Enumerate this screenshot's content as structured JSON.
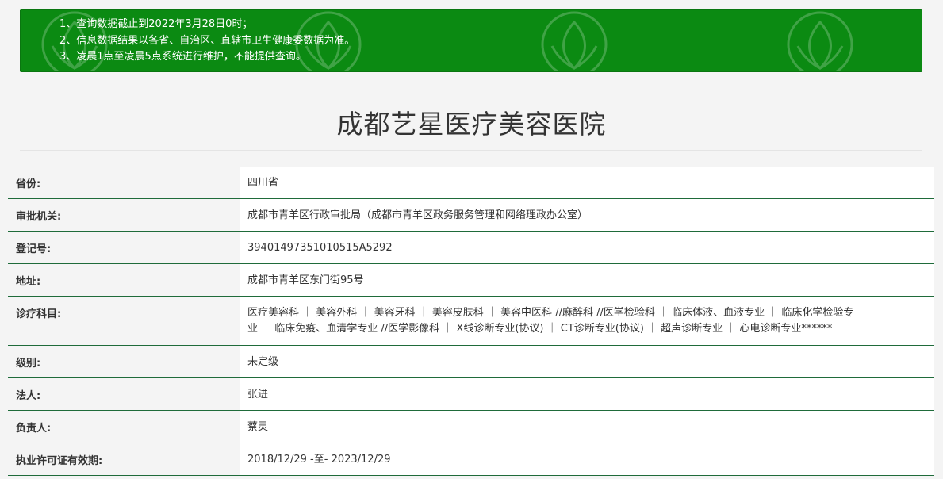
{
  "notice": {
    "items": [
      {
        "num": "1",
        "text": "查询数据截止到2022年3月28日0时；"
      },
      {
        "num": "2",
        "text": "信息数据结果以各省、自治区、直辖市卫生健康委数据为准。"
      },
      {
        "num": "3",
        "text": "凌晨1点至凌晨5点系统进行维护，不能提供查询。"
      }
    ]
  },
  "title": "成都艺星医疗美容医院",
  "rows": [
    {
      "label": "省份:",
      "value": "四川省"
    },
    {
      "label": "审批机关:",
      "value": "成都市青羊区行政审批局（成都市青羊区政务服务管理和网络理政办公室）"
    },
    {
      "label": "登记号:",
      "value": "39401497351010515A5292"
    },
    {
      "label": "地址:",
      "value": "成都市青羊区东门街95号"
    },
    {
      "label": "诊疗科目:",
      "value_line1": "医疗美容科 ｜ 美容外科 ｜ 美容牙科 ｜ 美容皮肤科 ｜ 美容中医科 //麻醉科 //医学检验科 ｜ 临床体液、血液专业 ｜ 临床化学检验专",
      "value_line2": "业 ｜ 临床免疫、血清学专业 //医学影像科 ｜ X线诊断专业(协议) ｜ CT诊断专业(协议) ｜ 超声诊断专业 ｜ 心电诊断专业******"
    },
    {
      "label": "级别:",
      "value": "未定级"
    },
    {
      "label": "法人:",
      "value": "张进"
    },
    {
      "label": "负责人:",
      "value": "蔡灵"
    },
    {
      "label": "执业许可证有效期:",
      "value": "2018/12/29 -至- 2023/12/29"
    }
  ]
}
